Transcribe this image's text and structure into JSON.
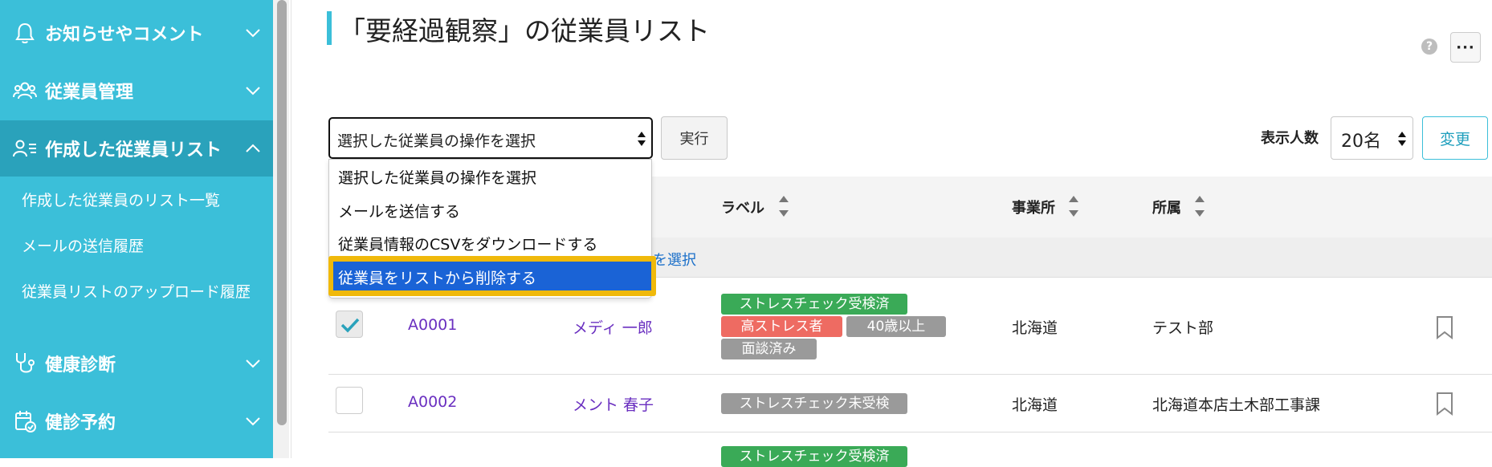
{
  "sidebar": {
    "items": [
      {
        "label": "お知らせやコメント",
        "icon": "bell-icon"
      },
      {
        "label": "従業員管理",
        "icon": "users-icon"
      },
      {
        "label": "作成した従業員リスト",
        "icon": "user-list-icon"
      },
      {
        "label": "健康診断",
        "icon": "stethoscope-icon"
      },
      {
        "label": "健診予約",
        "icon": "calendar-check-icon"
      }
    ],
    "sub_items": [
      {
        "label": "作成した従業員のリスト一覧"
      },
      {
        "label": "メールの送信履歴"
      },
      {
        "label": "従業員リストのアップロード履歴"
      }
    ]
  },
  "header": {
    "title": "「要経過観察」の従業員リスト",
    "help_label": "?",
    "more_label": "···"
  },
  "toolbar": {
    "action_select_value": "選択した従業員の操作を選択",
    "run_label": "実行",
    "perpage_label": "表示人数",
    "perpage_value": "20名",
    "change_label": "変更"
  },
  "dropdown": {
    "options": [
      "選択した従業員の操作を選択",
      "メールを送信する",
      "従業員情報のCSVをダウンロードする",
      "従業員をリストから削除する"
    ],
    "highlighted_index": 3
  },
  "table": {
    "headers": {
      "label": "ラベル",
      "office": "事業所",
      "department": "所属"
    },
    "select_all_text": "を選択",
    "rows": [
      {
        "checked": true,
        "id": "A0001",
        "name": "メディ 一郎",
        "badges": [
          {
            "text": "ストレスチェック受検済",
            "color": "green"
          },
          {
            "text": "高ストレス者",
            "color": "red"
          },
          {
            "text": "40歳以上",
            "color": "gray"
          },
          {
            "text": "面談済み",
            "color": "gray"
          }
        ],
        "office": "北海道",
        "department": "テスト部"
      },
      {
        "checked": false,
        "id": "A0002",
        "name": "メント 春子",
        "badges": [
          {
            "text": "ストレスチェック未受検",
            "color": "gray"
          }
        ],
        "office": "北海道",
        "department": "北海道本店土木部工事課"
      },
      {
        "badges": [
          {
            "text": "ストレスチェック受検済",
            "color": "green"
          }
        ]
      }
    ]
  },
  "colors": {
    "sidebar_bg": "#3bbfd9",
    "sidebar_active_bg": "#2aa2bb",
    "badge_green": "#3aaa57",
    "badge_red": "#ee6b62",
    "badge_gray": "#9a9a9a",
    "link_purple": "#6a2fc0",
    "dropdown_highlight": "#1a63d6",
    "highlight_frame": "#f0b90b"
  }
}
